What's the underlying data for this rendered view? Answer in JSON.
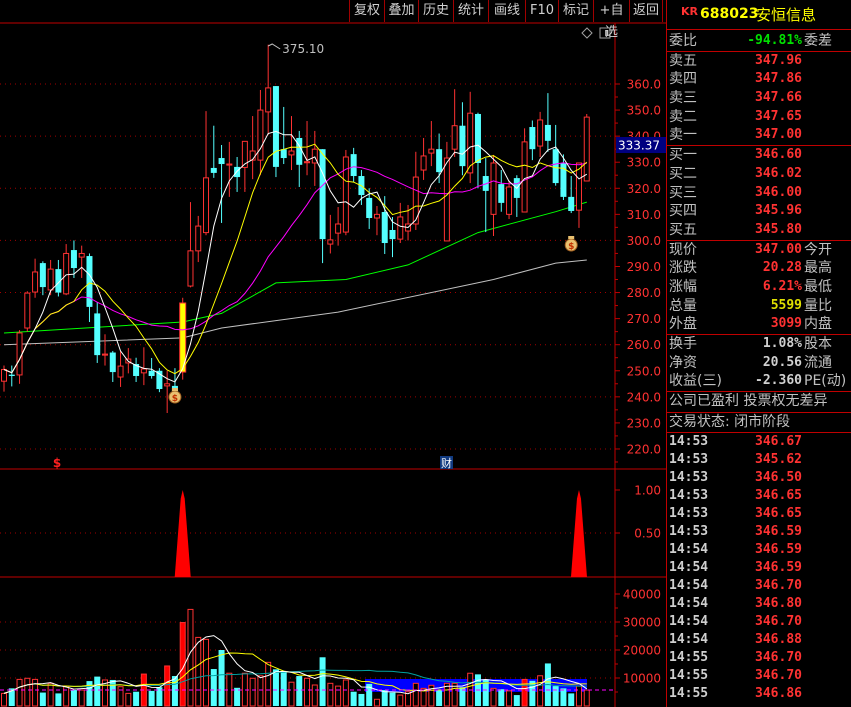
{
  "toolbar": [
    "复权",
    "叠加",
    "历史",
    "统计",
    "画线",
    "F10",
    "标记",
    "+自选",
    "返回"
  ],
  "stock": {
    "market": "KR",
    "code": "688023",
    "name": "安恒信息"
  },
  "weibi": {
    "label": "委比",
    "value": "-94.81%",
    "right": "委差"
  },
  "asks": [
    {
      "label": "卖五",
      "price": "347.96"
    },
    {
      "label": "卖四",
      "price": "347.86"
    },
    {
      "label": "卖三",
      "price": "347.66"
    },
    {
      "label": "卖二",
      "price": "347.65"
    },
    {
      "label": "卖一",
      "price": "347.00"
    }
  ],
  "bids": [
    {
      "label": "买一",
      "price": "346.60"
    },
    {
      "label": "买二",
      "price": "346.02"
    },
    {
      "label": "买三",
      "price": "346.00"
    },
    {
      "label": "买四",
      "price": "345.96"
    },
    {
      "label": "买五",
      "price": "345.80"
    }
  ],
  "quote": [
    {
      "label": "现价",
      "value": "347.00",
      "right": "今开",
      "color": "red"
    },
    {
      "label": "涨跌",
      "value": "20.28",
      "right": "最高",
      "color": "red"
    },
    {
      "label": "涨幅",
      "value": "6.21%",
      "right": "最低",
      "color": "red"
    },
    {
      "label": "总量",
      "value": "5599",
      "right": "量比",
      "color": "yellow"
    },
    {
      "label": "外盘",
      "value": "3099",
      "right": "内盘",
      "color": "red"
    }
  ],
  "fundamentals": [
    {
      "label": "换手",
      "value": "1.08%",
      "right": "股本"
    },
    {
      "label": "净资",
      "value": "20.56",
      "right": "流通"
    },
    {
      "label": "收益(三)",
      "value": "-2.360",
      "right": "PE(动)"
    }
  ],
  "notice": "公司已盈利 投票权无差异",
  "status": "交易状态: 闭市阶段",
  "ticks": [
    {
      "time": "14:53",
      "price": "346.67"
    },
    {
      "time": "14:53",
      "price": "345.62"
    },
    {
      "time": "14:53",
      "price": "346.50"
    },
    {
      "time": "14:53",
      "price": "346.65"
    },
    {
      "time": "14:53",
      "price": "346.65"
    },
    {
      "time": "14:53",
      "price": "346.59"
    },
    {
      "time": "14:54",
      "price": "346.59"
    },
    {
      "time": "14:54",
      "price": "346.59"
    },
    {
      "time": "14:54",
      "price": "346.70"
    },
    {
      "time": "14:54",
      "price": "346.80"
    },
    {
      "time": "14:54",
      "price": "346.70"
    },
    {
      "time": "14:54",
      "price": "346.88"
    },
    {
      "time": "14:55",
      "price": "346.70"
    },
    {
      "time": "14:55",
      "price": "346.70"
    },
    {
      "time": "14:55",
      "price": "346.86"
    }
  ],
  "colors": {
    "up": "#ff3232",
    "down": "#54ffff",
    "ma5": "#ffffff",
    "ma10": "#ffff00",
    "ma20": "#ff00ff",
    "ma60": "#00ff00",
    "ma120": "#c0c0c0",
    "grid": "#a00000",
    "crosshair_bg": "#000080"
  },
  "chart_data": {
    "type": "candlestick",
    "price_axis": {
      "min": 220,
      "max": 360,
      "ticks": [
        "360.0",
        "350.0",
        "340.0",
        "330.0",
        "320.0",
        "310.0",
        "300.0",
        "290.0",
        "280.0",
        "270.0",
        "260.0",
        "250.0",
        "240.0",
        "230.0",
        "220.0"
      ]
    },
    "high_label": "375.10",
    "crosshair_price": "333.37",
    "markers": {
      "dollar": "$",
      "finance": "财"
    },
    "ohlc": [
      [
        246,
        252,
        242,
        250.5
      ],
      [
        248.5,
        252,
        244,
        248
      ],
      [
        248.4,
        265.6,
        245,
        264.5
      ],
      [
        266.4,
        280.5,
        265,
        279.8
      ],
      [
        280.2,
        293,
        278,
        287.9
      ],
      [
        291.3,
        292,
        279,
        282.1
      ],
      [
        281,
        292.5,
        279,
        289
      ],
      [
        289,
        292.5,
        278.5,
        280
      ],
      [
        279.5,
        298.6,
        279,
        295
      ],
      [
        296.3,
        300,
        285.6,
        289.4
      ],
      [
        293.6,
        298,
        285.6,
        295
      ],
      [
        294,
        295,
        268.7,
        274.5
      ],
      [
        272,
        276.4,
        253,
        256
      ],
      [
        256,
        264,
        252,
        256.4
      ],
      [
        257,
        257.6,
        245.7,
        249.5
      ],
      [
        247.6,
        257.6,
        243.8,
        251.8
      ],
      [
        253,
        258.7,
        249,
        254.5
      ],
      [
        252.6,
        255,
        245.7,
        248
      ],
      [
        249.2,
        259,
        244.5,
        250.7
      ],
      [
        250,
        254.9,
        247,
        248
      ],
      [
        250,
        251,
        241.8,
        243
      ],
      [
        244.2,
        250,
        233.8,
        245
      ],
      [
        244.2,
        251,
        241,
        242
      ],
      [
        249.5,
        278,
        246.6,
        276
      ],
      [
        282.5,
        314.7,
        282,
        296
      ],
      [
        296,
        309.4,
        291.7,
        305.5
      ],
      [
        303,
        349.6,
        302,
        324
      ],
      [
        327.8,
        344,
        324,
        325.9
      ],
      [
        331.6,
        336.6,
        306.7,
        329.3
      ],
      [
        328.9,
        337.8,
        316.7,
        329.3
      ],
      [
        328.2,
        332,
        318.6,
        324.3
      ],
      [
        328,
        338,
        318.6,
        338
      ],
      [
        330.8,
        347.7,
        323.5,
        334.3
      ],
      [
        330.8,
        357.7,
        325,
        350
      ],
      [
        349.3,
        375.1,
        340.4,
        358.5
      ],
      [
        359.2,
        359.2,
        324.3,
        328.2
      ],
      [
        335,
        351.2,
        329.3,
        331.6
      ],
      [
        332.8,
        347.7,
        327,
        334.3
      ],
      [
        339.3,
        342,
        320.5,
        329
      ],
      [
        329.8,
        345.8,
        325,
        330.2
      ],
      [
        329.7,
        342,
        320.9,
        335
      ],
      [
        335,
        335,
        291.3,
        300.5
      ],
      [
        298.6,
        309.8,
        295,
        300.2
      ],
      [
        302.8,
        312.8,
        298,
        306.3
      ],
      [
        303.2,
        334.7,
        302,
        332
      ],
      [
        333.1,
        335.5,
        322.4,
        324.7
      ],
      [
        324.7,
        327,
        313.6,
        317.4
      ],
      [
        316.3,
        320,
        304.4,
        308.6
      ],
      [
        308.6,
        313.2,
        302,
        310
      ],
      [
        310.9,
        317,
        294.8,
        299
      ],
      [
        304,
        309,
        293.6,
        300.5
      ],
      [
        300.5,
        314.4,
        299,
        309
      ],
      [
        303.6,
        313.6,
        300,
        306.3
      ],
      [
        306.3,
        334,
        304,
        324.3
      ],
      [
        327,
        339.3,
        323.2,
        332.4
      ],
      [
        333.5,
        345.8,
        328.5,
        335
      ],
      [
        335,
        341,
        322,
        326.2
      ],
      [
        299.8,
        337.8,
        299.8,
        331.6
      ],
      [
        335,
        358,
        332,
        344
      ],
      [
        344,
        353,
        325,
        328.5
      ],
      [
        325.9,
        357,
        322,
        348.8
      ],
      [
        348.5,
        349,
        320,
        329.7
      ],
      [
        324.7,
        331.6,
        303.2,
        319
      ],
      [
        310,
        332.8,
        301.7,
        329.7
      ],
      [
        321.6,
        327,
        311,
        314.4
      ],
      [
        310,
        323,
        308.2,
        320.5
      ],
      [
        323.9,
        325,
        309,
        316.3
      ],
      [
        310.9,
        343,
        310.9,
        337.8
      ],
      [
        343.5,
        346,
        330.8,
        335
      ],
      [
        336.2,
        349.3,
        332,
        346.2
      ],
      [
        344.3,
        356.5,
        334,
        338.2
      ],
      [
        335,
        344.3,
        321,
        322
      ],
      [
        329.7,
        333,
        315.5,
        316.7
      ],
      [
        316.7,
        324.7,
        310.5,
        311.3
      ],
      [
        311.6,
        329.7,
        304.8,
        329.7
      ],
      [
        322.8,
        348.5,
        322.8,
        347.3
      ]
    ],
    "highlight_index": 23,
    "ma60": [
      [
        0,
        264.5
      ],
      [
        23,
        268.7
      ],
      [
        28,
        272
      ],
      [
        35,
        283.7
      ],
      [
        44,
        285
      ],
      [
        52,
        290.6
      ],
      [
        61,
        303
      ],
      [
        71,
        311
      ],
      [
        75,
        314.7
      ]
    ],
    "ma120": [
      [
        0,
        260
      ],
      [
        23,
        262.6
      ],
      [
        28,
        266.4
      ],
      [
        43,
        272.5
      ],
      [
        63,
        285
      ],
      [
        71,
        291.3
      ],
      [
        75,
        292.5
      ]
    ],
    "indicator": {
      "axis": [
        "1.00",
        "0.50"
      ],
      "max": 1.0,
      "signals": [
        {
          "index": 23,
          "value": 1.0
        },
        {
          "index": 74,
          "value": 1.0
        }
      ]
    },
    "volume": {
      "axis": [
        "40000",
        "30000",
        "20000",
        "10000"
      ],
      "max": 45000,
      "values": [
        4500,
        6300,
        9500,
        9900,
        9500,
        4800,
        8100,
        4500,
        7100,
        5700,
        5700,
        8900,
        10500,
        9300,
        9300,
        6900,
        4500,
        5100,
        11400,
        5400,
        6700,
        14300,
        10700,
        29800,
        34500,
        24500,
        23800,
        13200,
        20000,
        11700,
        6500,
        11700,
        9900,
        10800,
        15600,
        13100,
        12300,
        8500,
        10700,
        9900,
        7500,
        17400,
        8100,
        7100,
        9300,
        5100,
        4300,
        7900,
        2400,
        5700,
        4800,
        3900,
        5100,
        8100,
        6300,
        7400,
        5500,
        8100,
        8100,
        6700,
        11700,
        11300,
        9500,
        6300,
        6000,
        5400,
        3900,
        9500,
        9000,
        10800,
        15200,
        7100,
        6300,
        4500,
        7100,
        5700
      ]
    }
  }
}
